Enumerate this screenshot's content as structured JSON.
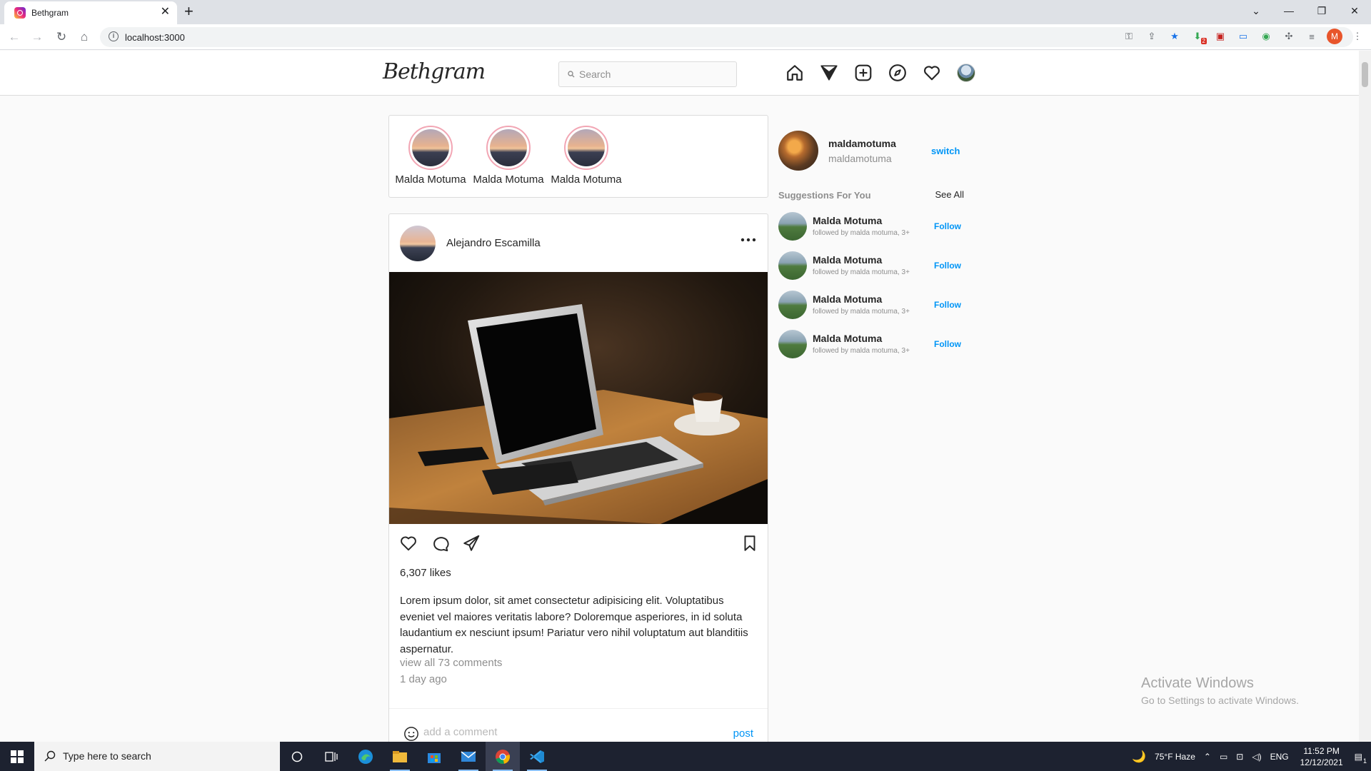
{
  "browser": {
    "tab_title": "Bethgram",
    "url": "localhost:3000",
    "profile_initial": "M",
    "extension_badge": "2"
  },
  "header": {
    "logo": "Bethgram",
    "search_placeholder": "Search",
    "nav_icons": [
      "home-icon",
      "direct-icon",
      "new-post-icon",
      "explore-icon",
      "activity-icon",
      "profile-avatar"
    ]
  },
  "stories": [
    {
      "name": "Malda Motuma"
    },
    {
      "name": "Malda Motuma"
    },
    {
      "name": "Malda Motuma"
    }
  ],
  "post": {
    "username": "Alejandro Escamilla",
    "likes": "6,307 likes",
    "caption": "Lorem ipsum dolor, sit amet consectetur adipisicing elit. Voluptatibus eveniet vel maiores veritatis labore? Doloremque asperiores, in id soluta laudantium ex nesciunt ipsum! Pariatur vero nihil voluptatum aut blanditiis aspernatur.",
    "view_comments": "view all 73 comments",
    "time_ago": "1 day ago",
    "comment_placeholder": "add a comment",
    "post_button": "post"
  },
  "sidebar": {
    "username": "maldamotuma",
    "name": "maldamotuma",
    "switch_label": "switch",
    "suggestions_title": "Suggestions For You",
    "see_all": "See All",
    "suggestions": [
      {
        "name": "Malda Motuma",
        "sub": "followed by malda motuma, 3+",
        "action": "Follow"
      },
      {
        "name": "Malda Motuma",
        "sub": "followed by malda motuma, 3+",
        "action": "Follow"
      },
      {
        "name": "Malda Motuma",
        "sub": "followed by malda motuma, 3+",
        "action": "Follow"
      },
      {
        "name": "Malda Motuma",
        "sub": "followed by malda motuma, 3+",
        "action": "Follow"
      }
    ]
  },
  "watermark": {
    "title": "Activate Windows",
    "subtitle": "Go to Settings to activate Windows."
  },
  "taskbar": {
    "search_text": "Type here to search",
    "weather": "75°F  Haze",
    "language": "ENG",
    "time": "11:52 PM",
    "date": "12/12/2021",
    "notification_count": "1"
  },
  "colors": {
    "accent": "#0095f6",
    "story_ring": "#f2a6b4",
    "border": "#dbdbdb"
  }
}
